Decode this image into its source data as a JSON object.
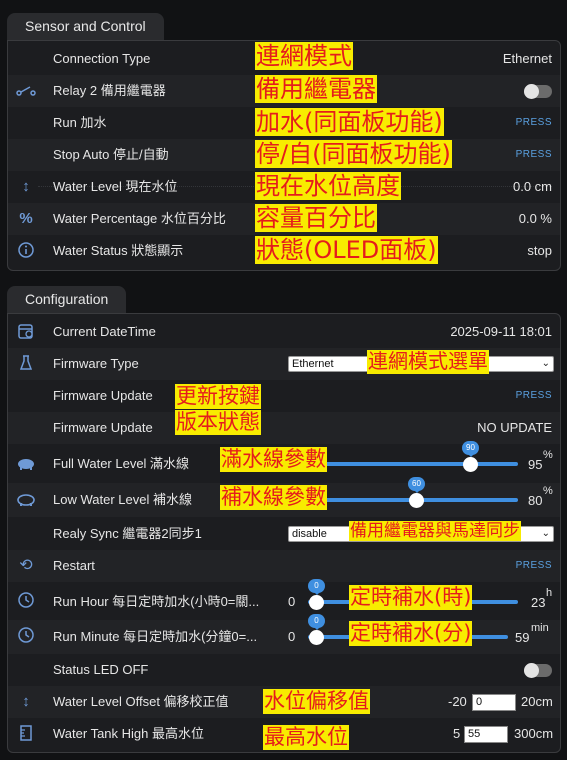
{
  "sensor_panel": {
    "title": "Sensor and Control",
    "rows": [
      {
        "label": "Connection Type",
        "value": "Ethernet"
      },
      {
        "label": "Relay 2 備用繼電器"
      },
      {
        "label": "Run 加水",
        "button": "PRESS"
      },
      {
        "label": "Stop Auto 停止/自動",
        "button": "PRESS"
      },
      {
        "label": "Water Level 現在水位",
        "value": "0.0 cm"
      },
      {
        "label": "Water Percentage 水位百分比",
        "value": "0.0 %"
      },
      {
        "label": "Water Status 狀態顯示",
        "value": "stop"
      }
    ],
    "annotations": [
      "連網模式",
      "備用繼電器",
      "加水(同面板功能)",
      "停/自(同面板功能)",
      "現在水位高度",
      "容量百分比",
      "狀態(OLED面板)"
    ]
  },
  "config_panel": {
    "title": "Configuration",
    "current_datetime": {
      "label": "Current DateTime",
      "value": "2025-09-11 18:01"
    },
    "firmware_type": {
      "label": "Firmware Type",
      "selected": "Ethernet",
      "annotation": "連網模式選單"
    },
    "firmware_update_button": {
      "label": "Firmware Update",
      "button": "PRESS",
      "annotation": "更新按鍵"
    },
    "firmware_update_status": {
      "label": "Firmware Update",
      "value": "NO UPDATE",
      "annotation": "版本狀態"
    },
    "full_water_level": {
      "label": "Full Water Level 滿水線",
      "bubble": "90",
      "max": "95",
      "unit": "%",
      "level": 90,
      "annotation": "滿水線參數"
    },
    "low_water_level": {
      "label": "Low Water Level 補水線",
      "bubble": "60",
      "max": "80",
      "unit": "%",
      "level": 60,
      "annotation": "補水線參數"
    },
    "relay_sync": {
      "label": "Realy Sync 繼電器2同步1",
      "selected": "disable",
      "annotation": "備用繼電器與馬達同步"
    },
    "restart": {
      "label": "Restart",
      "button": "PRESS"
    },
    "run_hour": {
      "label": "Run Hour 每日定時加水(小時0=關...",
      "min": "0",
      "bubble": "0",
      "max": "23",
      "unit": "h",
      "level": 0,
      "annotation": "定時補水(時)"
    },
    "run_minute": {
      "label": "Run Minute 每日定時加水(分鐘0=...",
      "min": "0",
      "bubble": "0",
      "max": "59",
      "unit": "min",
      "level": 0,
      "annotation": "定時補水(分)"
    },
    "status_led": {
      "label": "Status LED OFF"
    },
    "water_level_offset": {
      "label": "Water Level Offset 偏移校正值",
      "min": "-20",
      "input": "0",
      "max": "20cm",
      "annotation": "水位偏移值"
    },
    "water_tank_high": {
      "label": "Water Tank High 最高水位",
      "min": "5",
      "input": "55",
      "max": "300cm",
      "annotation": "最高水位"
    }
  },
  "colors": {
    "accent": "#3f8fe0",
    "annotation_bg": "#f8ec00",
    "annotation_text": "#e51c1c"
  },
  "icons": [
    "relay-icon",
    "arrows-vertical-icon",
    "percent-icon",
    "info-icon",
    "calendar-clock-icon",
    "flask-icon",
    "full-tank-icon",
    "low-tank-icon",
    "restart-icon",
    "clock-icon",
    "ruler-icon"
  ]
}
